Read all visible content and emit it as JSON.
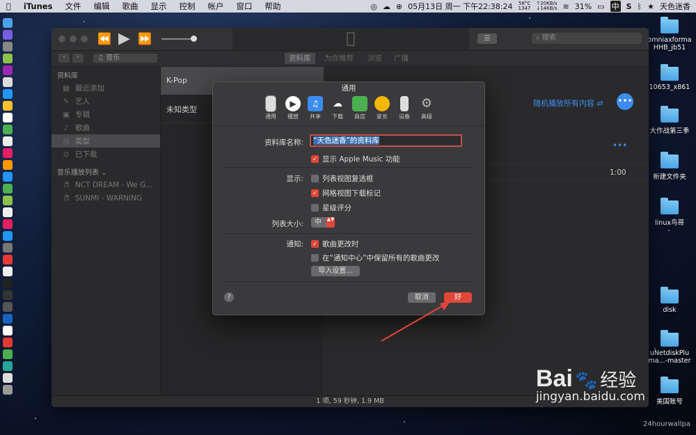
{
  "menubar": {
    "app": "iTunes",
    "items": [
      "文件",
      "编辑",
      "歌曲",
      "显示",
      "控制",
      "帐户",
      "窗口",
      "帮助"
    ],
    "datetime": "05月13日 周一 下午22:38:24",
    "temp": "58°C",
    "temp2": "1347",
    "net_up": "↑20KB/s",
    "net_down": "↓14KB/s",
    "battery": "31%",
    "input": "中",
    "user": "天色迷香"
  },
  "desktop": {
    "items": [
      "omniaxforma\nHHB_jb51",
      "10653_x861",
      "大作战第三季",
      "新建文件夹",
      "linux鸟哥",
      "disk",
      "uNetdiskPlu\nma...-master",
      "美国账号"
    ]
  },
  "itunes": {
    "search_placeholder": "搜索",
    "media_select": "音乐",
    "tabs": [
      "资料库",
      "为你推荐",
      "浏览",
      "广播"
    ],
    "sidebar": {
      "library_header": "资料库",
      "library_items": [
        {
          "icon": "recent-icon",
          "label": "最近添加"
        },
        {
          "icon": "artist-icon",
          "label": "艺人"
        },
        {
          "icon": "album-icon",
          "label": "专辑"
        },
        {
          "icon": "note-icon",
          "label": "歌曲"
        },
        {
          "icon": "genre-icon",
          "label": "类型"
        },
        {
          "icon": "download-icon",
          "label": "已下载"
        }
      ],
      "playlists_header": "音乐播放列表",
      "playlists": [
        "NCT DREAM - We G...",
        "SUNMI - WARNING"
      ]
    },
    "genres": [
      "K-Pop",
      "未知类型"
    ],
    "main": {
      "shuffle": "随机播放所有内容",
      "duration": "1:00"
    },
    "status": "1 项, 59 秒钟, 1.9 MB"
  },
  "dialog": {
    "title": "通用",
    "tabs": [
      {
        "label": "通用",
        "icon": "general-icon"
      },
      {
        "label": "播放",
        "icon": "play-icon"
      },
      {
        "label": "共享",
        "icon": "share-icon"
      },
      {
        "label": "下载",
        "icon": "download-icon"
      },
      {
        "label": "商店",
        "icon": "store-icon"
      },
      {
        "label": "家长",
        "icon": "parental-icon"
      },
      {
        "label": "设备",
        "icon": "device-icon"
      },
      {
        "label": "高级",
        "icon": "gear-icon"
      }
    ],
    "library_name_label": "资料库名称:",
    "library_name_value": "“天色迷香”的资料库",
    "show_apple_music": "显示 Apple Music 功能",
    "show_label": "显示:",
    "show_options": [
      "列表视图复选框",
      "网格视图下载标记",
      "星级评分"
    ],
    "list_size_label": "列表大小:",
    "list_size_value": "中",
    "notify_label": "通知:",
    "notify_options": [
      "歌曲更改时",
      "在“通知中心”中保留所有的歌曲更改"
    ],
    "import_button": "导入设置...",
    "help": "?",
    "cancel": "取消",
    "ok": "好"
  },
  "watermark": {
    "logo": "Bai",
    "logo2": "经验",
    "url": "jingyan.baidu.com",
    "corner": "24hourwallpa"
  },
  "colors": {
    "accent": "#e0473a",
    "link": "#3b8df0"
  }
}
